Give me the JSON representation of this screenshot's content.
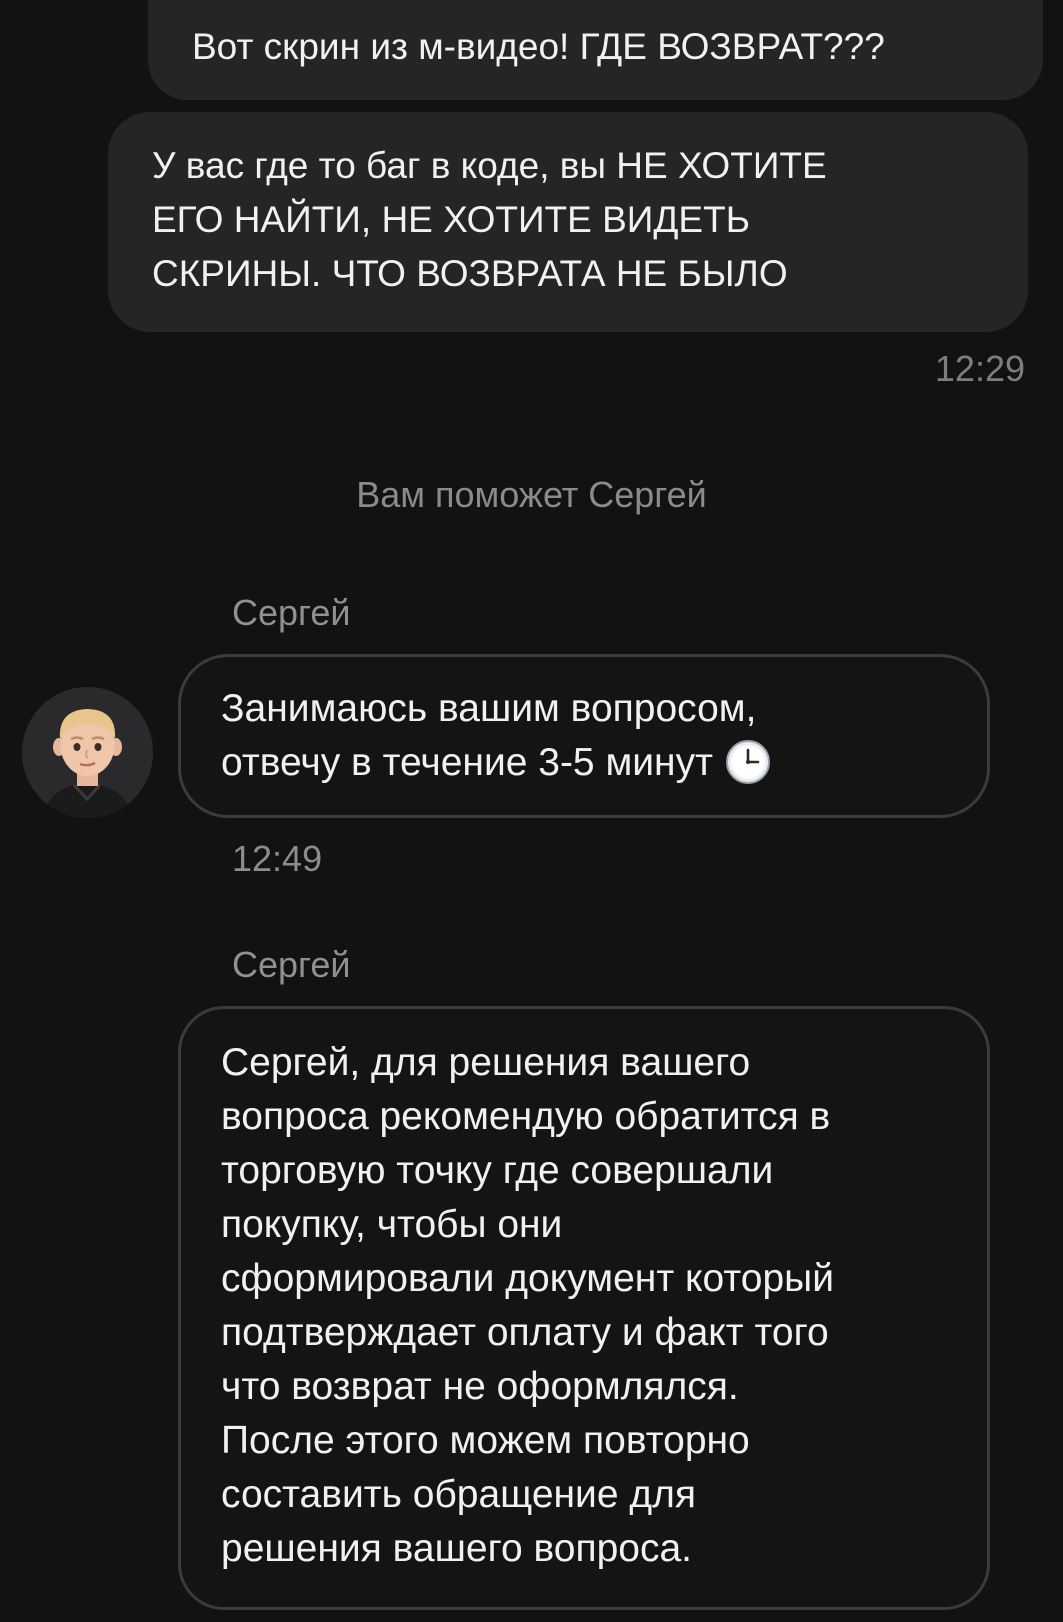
{
  "messages_outgoing": [
    {
      "lines": [
        "Вот скрин из м-видео! ГДЕ ВОЗВРАТ???"
      ]
    },
    {
      "lines": [
        "У вас где то баг в коде, вы НЕ ХОТИТЕ",
        "ЕГО НАЙТИ, НЕ ХОТИТЕ ВИДЕТЬ",
        "СКРИНЫ. ЧТО ВОЗВРАТА НЕ БЫЛО"
      ]
    }
  ],
  "outgoing_time": "12:29",
  "system_note": "Вам поможет Сергей",
  "incoming": [
    {
      "sender": "Сергей",
      "lines": [
        "Занимаюсь вашим вопросом,",
        "отвечу в течение 3-5 минут"
      ],
      "emoji_icon": "clock-icon",
      "time": "12:49"
    },
    {
      "sender": "Сергей",
      "lines": [
        "Сергей, для решения вашего",
        "вопроса рекомендую обратится в",
        "торговую точку где совершали",
        "покупку, чтобы они",
        "сформировали документ который",
        "подтверждает оплату и факт того",
        "что возврат не оформлялся.",
        "После этого можем повторно",
        "составить обращение для",
        "решения вашего вопроса."
      ]
    }
  ],
  "colors": {
    "background": "#121212",
    "outgoing_bubble": "#252527",
    "incoming_border": "#3b3b3e",
    "meta_text": "#8a8a8f"
  }
}
